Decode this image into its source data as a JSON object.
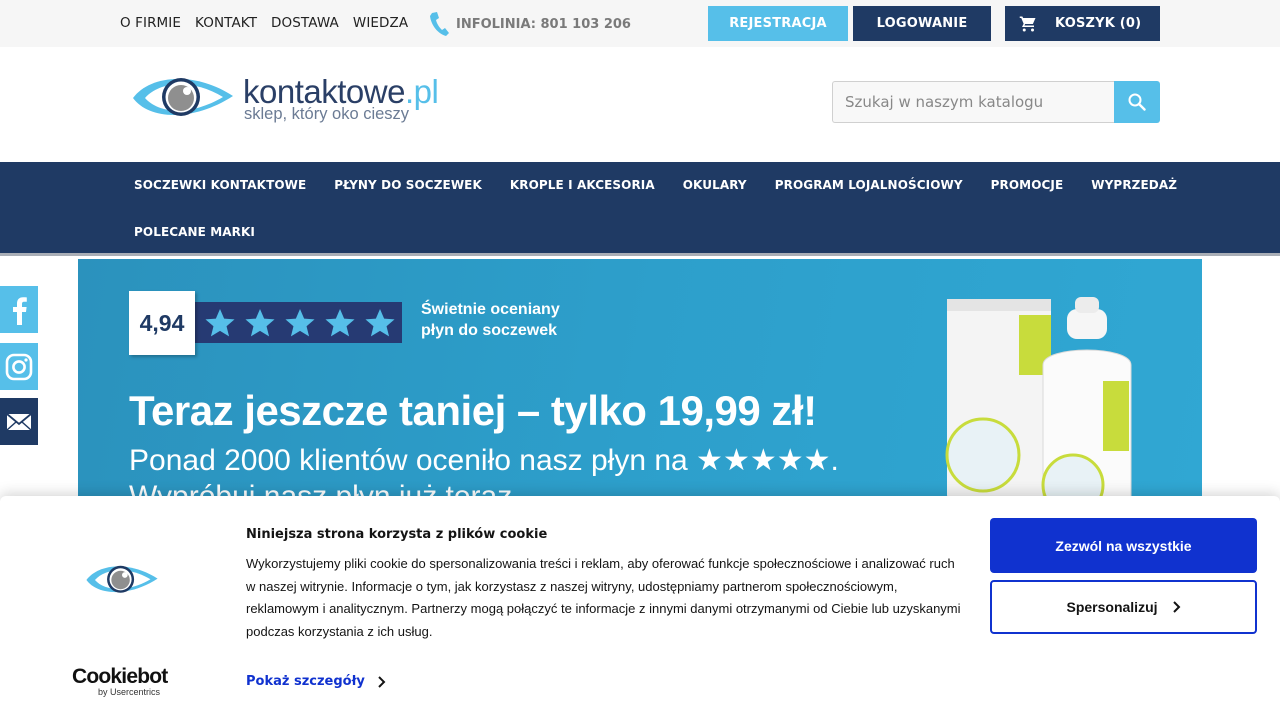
{
  "topbar": {
    "links": [
      "O FIRMIE",
      "KONTAKT",
      "DOSTAWA",
      "WIEDZA"
    ],
    "hotline": "INFOLINIA: 801 103 206",
    "register": "REJESTRACJA",
    "login": "LOGOWANIE",
    "cart": "KOSZYK (0)"
  },
  "header": {
    "logo_name": "kontaktowe",
    "logo_tld": ".pl",
    "logo_tagline": "sklep, który oko cieszy",
    "search_placeholder": "Szukaj w naszym katalogu"
  },
  "nav": {
    "row1": [
      "SOCZEWKI KONTAKTOWE",
      "PŁYNY DO SOCZEWEK",
      "KROPLE I AKCESORIA",
      "OKULARY",
      "PROGRAM LOJALNOŚCIOWY",
      "PROMOCJE",
      "WYPRZEDAŻ"
    ],
    "row2": [
      "POLECANE MARKI"
    ]
  },
  "banner": {
    "rating": "4,94",
    "rated_line1": "Świetnie oceniany",
    "rated_line2": "płyn do soczewek",
    "headline": "Teraz jeszcze taniej – tylko 19,99 zł!",
    "subline1": "Ponad 2000 klientów oceniło nasz płyn na ★★★★★.",
    "subline2": "Wypróbuj nasz płyn już teraz."
  },
  "cookie": {
    "title": "Niniejsza strona korzysta z plików cookie",
    "text": "Wykorzystujemy pliki cookie do spersonalizowania treści i reklam, aby oferować funkcje społecznościowe i analizować ruch w naszej witrynie. Informacje o tym, jak korzystasz z naszej witryny, udostępniamy partnerom społecznościowym, reklamowym i analitycznym. Partnerzy mogą połączyć te informacje z innymi danymi otrzymanymi od Ciebie lub uzyskanymi podczas korzystania z ich usług.",
    "details": "Pokaż szczegóły",
    "allow_all": "Zezwól na wszystkie",
    "customize": "Spersonalizuj",
    "brand": "Cookiebot",
    "brand_by": "by Usercentrics"
  },
  "colors": {
    "navy": "#1f3a64",
    "sky": "#56bfe9",
    "cookie_blue": "#1032cf"
  },
  "icons": {
    "hotline": "phone-icon",
    "cart": "cart-icon",
    "search": "search-icon",
    "social": [
      "facebook-icon",
      "instagram-icon",
      "mail-icon"
    ]
  }
}
